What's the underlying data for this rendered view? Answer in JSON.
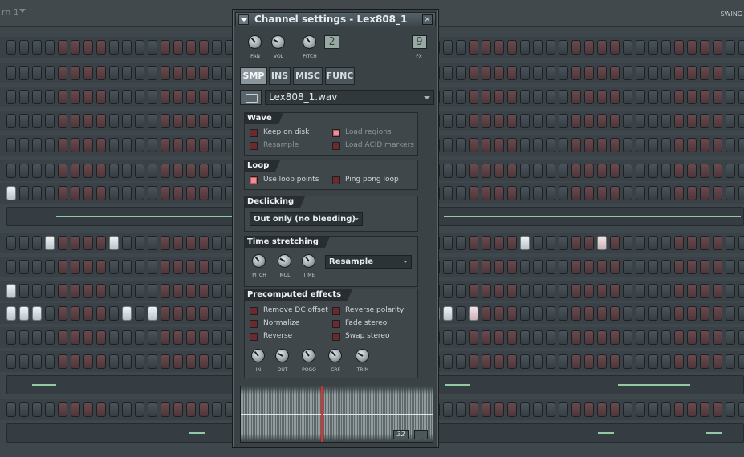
{
  "window": {
    "pattern_label": "rn 1",
    "swing_label": "SWING"
  },
  "channel_settings": {
    "title": "Channel settings - Lex808_1",
    "close_icon": "close-icon",
    "knobs": [
      {
        "label": "PAN"
      },
      {
        "label": "VOL"
      },
      {
        "label": "PITCH"
      }
    ],
    "pitch_range": "2",
    "fx_label": "FX",
    "fx_channel": "9",
    "tabs": [
      "SMP",
      "INS",
      "MISC",
      "FUNC"
    ],
    "active_tab": "SMP",
    "sample_file": "Lex808_1.wav",
    "sections": {
      "wave": {
        "title": "Wave",
        "options": [
          {
            "label": "Keep on disk",
            "checked": false,
            "enabled": true
          },
          {
            "label": "Load regions",
            "checked": true,
            "enabled": false
          },
          {
            "label": "Resample",
            "checked": false,
            "enabled": false
          },
          {
            "label": "Load ACID markers",
            "checked": false,
            "enabled": false
          }
        ]
      },
      "loop": {
        "title": "Loop",
        "options": [
          {
            "label": "Use loop points",
            "checked": true,
            "enabled": true
          },
          {
            "label": "Ping pong loop",
            "checked": false,
            "enabled": true
          }
        ]
      },
      "declicking": {
        "title": "Declicking",
        "mode": "Out only (no bleeding)"
      },
      "time_stretching": {
        "title": "Time stretching",
        "knob_labels": [
          "PITCH",
          "MUL",
          "TIME"
        ],
        "mode": "Resample"
      },
      "precomputed_effects": {
        "title": "Precomputed effects",
        "options": [
          {
            "label": "Remove DC offset",
            "checked": false
          },
          {
            "label": "Reverse polarity",
            "checked": false
          },
          {
            "label": "Normalize",
            "checked": false
          },
          {
            "label": "Fade stereo",
            "checked": false
          },
          {
            "label": "Reverse",
            "checked": false
          },
          {
            "label": "Swap stereo",
            "checked": false
          }
        ],
        "knob_labels": [
          "IN",
          "OUT",
          "POGO",
          "CRF",
          "TRIM"
        ]
      }
    },
    "waveform": {
      "counter": "32",
      "playhead_position": 0.42
    }
  },
  "step_sequencer": {
    "rows": 12
  }
}
